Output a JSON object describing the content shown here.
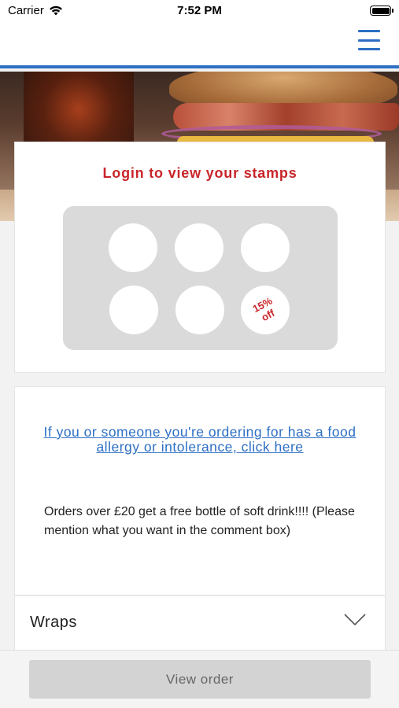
{
  "status_bar": {
    "carrier": "Carrier",
    "time": "7:52 PM",
    "icons": [
      "wifi-icon",
      "battery-icon"
    ]
  },
  "header": {
    "menu_icon": "hamburger-menu-icon",
    "accent_color": "#2d6fc4"
  },
  "stamps": {
    "title": "Login to view your stamps",
    "title_color": "#c8252a",
    "total_slots": 6,
    "reward_line1": "15%",
    "reward_line2": "off"
  },
  "info": {
    "allergy_link": "If you or someone you're ordering for has a food allergy or intolerance, click here",
    "promo": "Orders over £20 get a free bottle of soft drink!!!! (Please mention what you want in the comment box)"
  },
  "categories": [
    {
      "label": "Wraps",
      "icon": "chevron-down-icon"
    }
  ],
  "footer": {
    "view_order_label": "View order"
  }
}
